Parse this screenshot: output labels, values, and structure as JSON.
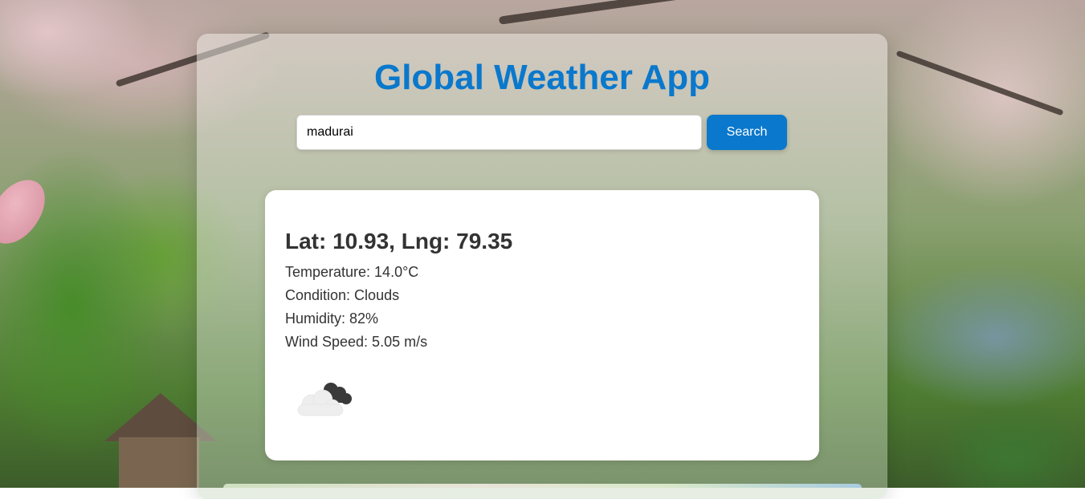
{
  "app": {
    "title": "Global Weather App"
  },
  "search": {
    "value": "madurai",
    "button_label": "Search"
  },
  "weather": {
    "coordinates": "Lat: 10.93, Lng: 79.35",
    "temperature": "Temperature: 14.0°C",
    "condition": "Condition: Clouds",
    "humidity": "Humidity: 82%",
    "wind_speed": "Wind Speed: 5.05 m/s",
    "icon": "broken-clouds-icon"
  },
  "colors": {
    "accent": "#0a78cc",
    "card": "#ffffff",
    "text": "#333333"
  }
}
